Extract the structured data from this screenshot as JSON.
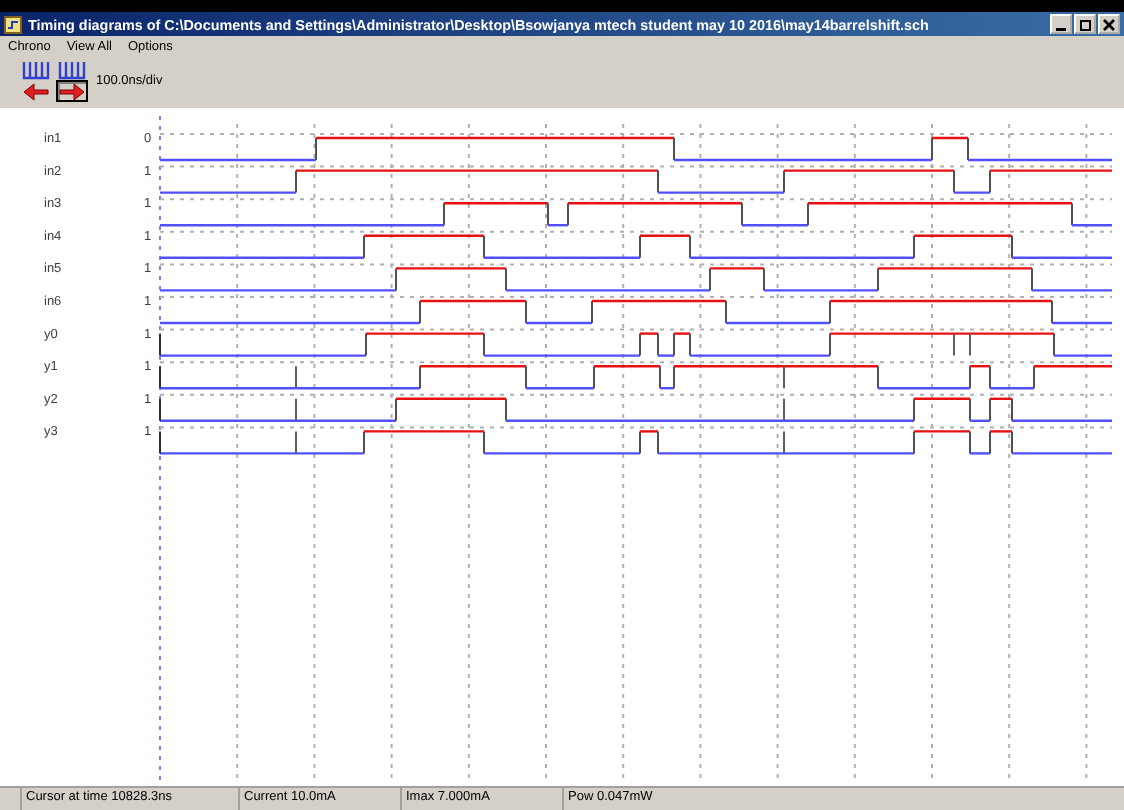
{
  "window": {
    "title": "Timing diagrams of C:\\Documents and Settings\\Administrator\\Desktop\\Bsowjanya mtech student may 10 2016\\may14barrelshift.sch"
  },
  "menu": [
    "Chrono",
    "View All",
    "Options"
  ],
  "toolbar": {
    "scale": "100.0ns/div",
    "buttons": [
      {
        "selected": false
      },
      {
        "selected": true
      }
    ]
  },
  "signals": [
    {
      "name": "in1",
      "value": "0"
    },
    {
      "name": "in2",
      "value": "1"
    },
    {
      "name": "in3",
      "value": "1"
    },
    {
      "name": "in4",
      "value": "1"
    },
    {
      "name": "in5",
      "value": "1"
    },
    {
      "name": "in6",
      "value": "1"
    },
    {
      "name": "y0",
      "value": "1"
    },
    {
      "name": "y1",
      "value": "1"
    },
    {
      "name": "y2",
      "value": "1"
    },
    {
      "name": "y3",
      "value": "1"
    }
  ],
  "status_bar": [
    "Cursor at time 10828.3ns",
    "Current 10.0mA",
    "Imax 7.000mA",
    "Pow 0.047mW"
  ]
}
